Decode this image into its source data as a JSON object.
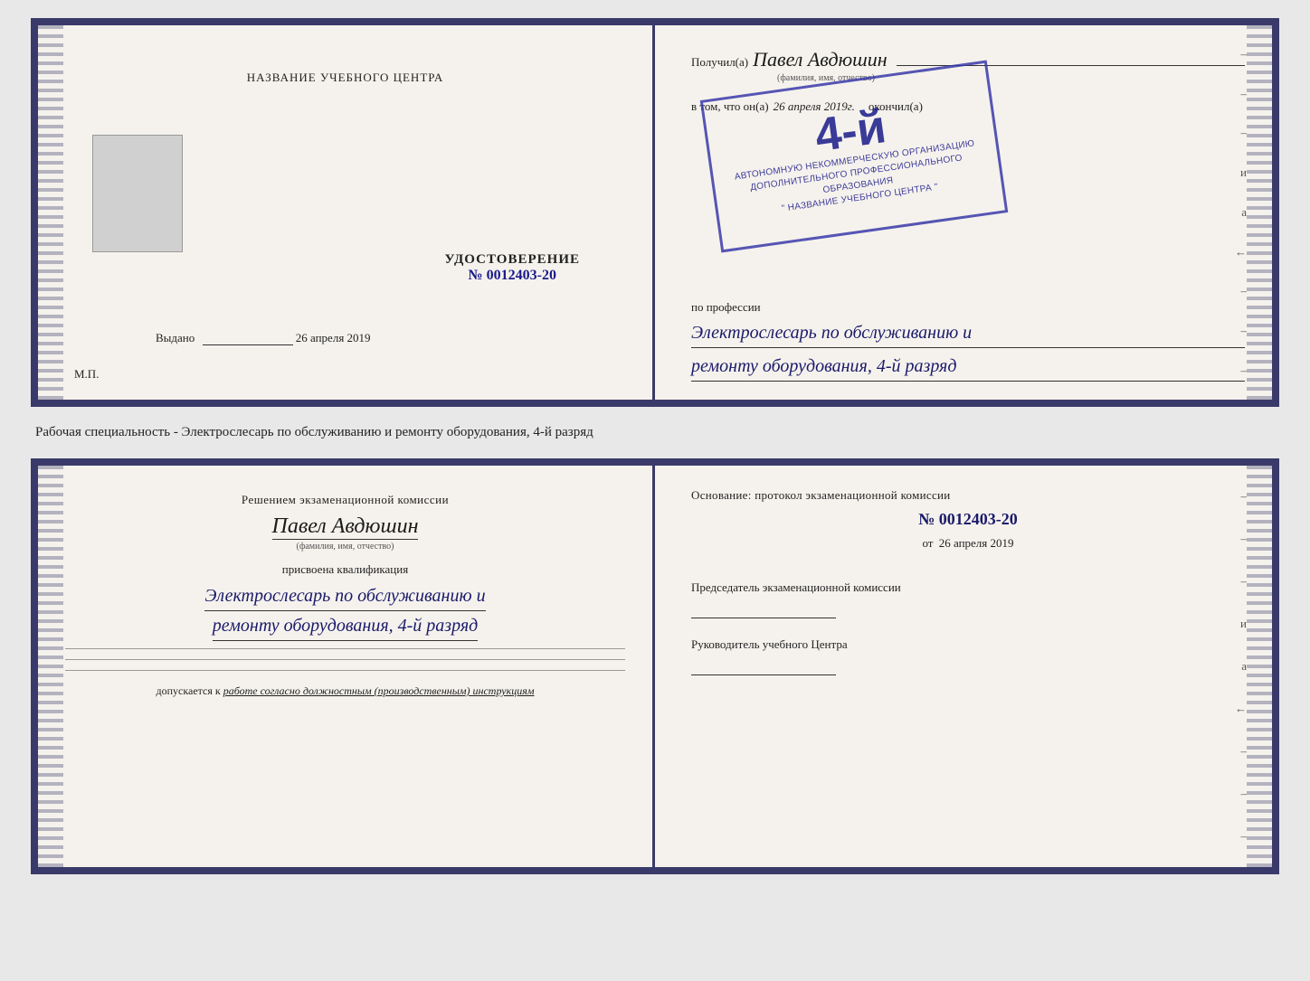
{
  "top_document": {
    "left": {
      "title": "НАЗВАНИЕ УЧЕБНОГО ЦЕНТРА",
      "udostoverenie_label": "УДОСТОВЕРЕНИЕ",
      "number": "№ 0012403-20",
      "vydano_label": "Выдано",
      "vydano_date": "26 апреля 2019",
      "mp_label": "М.П."
    },
    "right": {
      "poluchil_prefix": "Получил(a)",
      "name_handwritten": "Павел Авдюшин",
      "name_subtext": "(фамилия, имя, отчество)",
      "vtom_prefix": "в том, что он(a)",
      "vtom_date": "26 апреля 2019г.",
      "okonchil_label": "окончил(a)",
      "stamp_grade": "4-й",
      "stamp_line1": "АВТОНОМНУЮ НЕКОММЕРЧЕСКУЮ ОРГАНИЗАЦИЮ",
      "stamp_line2": "ДОПОЛНИТЕЛЬНОГО ПРОФЕССИОНАЛЬНОГО ОБРАЗОВАНИЯ",
      "stamp_line3": "\" НАЗВАНИЕ УЧЕБНОГО ЦЕНТРА \"",
      "po_professii": "по профессии",
      "profession_line1": "Электрослесарь по обслуживанию и",
      "profession_line2": "ремонту оборудования, 4-й разряд"
    }
  },
  "between_text": "Рабочая специальность - Электрослесарь по обслуживанию и ремонту оборудования, 4-й разряд",
  "bottom_document": {
    "left": {
      "resheniem_text": "Решением экзаменационной комиссии",
      "name_handwritten": "Павел Авдюшин",
      "name_subtext": "(фамилия, имя, отчество)",
      "prisvoena_label": "присвоена квалификация",
      "qualification_line1": "Электрослесарь по обслуживанию и",
      "qualification_line2": "ремонту оборудования, 4-й разряд",
      "dopuskaetsya_prefix": "допускается к",
      "dopuskaetsya_text": "работе согласно должностным (производственным) инструкциям"
    },
    "right": {
      "osnovanie_text": "Основание: протокол экзаменационной комиссии",
      "number": "№ 0012403-20",
      "ot_prefix": "от",
      "ot_date": "26 апреля 2019",
      "predsedatel_label": "Председатель экзаменационной комиссии",
      "rukovoditel_label": "Руководитель учебного Центра"
    }
  },
  "deco_chars": {
    "items": [
      "–",
      "–",
      "–",
      "и",
      "ɑ",
      "←",
      "–",
      "–",
      "–"
    ]
  }
}
